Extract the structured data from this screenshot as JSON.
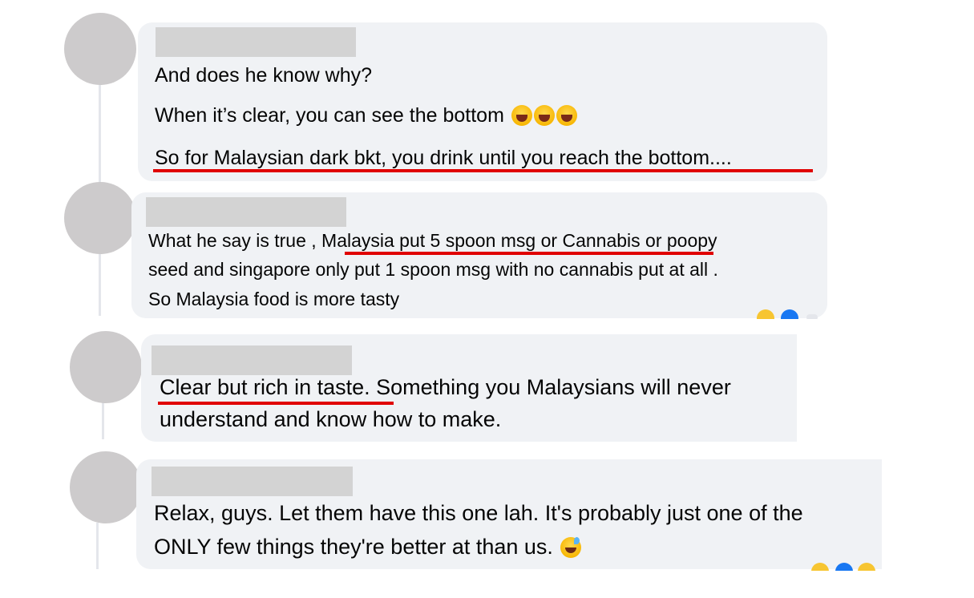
{
  "comments": [
    {
      "lines": [
        "And does he know why?",
        "When it’s clear, you can see the bottom",
        "So for Malaysian dark bkt, you drink until you reach the bottom...."
      ],
      "emoji": [
        "laughing-tears",
        "laughing-tears",
        "laughing-tears"
      ],
      "highlighted": "So for Malaysian dark bkt, you drink until you reach the bottom...."
    },
    {
      "line1_pre": "What he say is true , ",
      "line1_hl": "Malaysia put 5 spoon msg or Cannabis",
      "line1_post": " or poopy",
      "line2": "seed and singapore only put 1 spoon msg with no cannabis put at all .",
      "line3": "So Malaysia food is more tasty",
      "reactions": [
        "haha",
        "like"
      ]
    },
    {
      "line1_hl": "Clear but rich in taste.",
      "line1_post": " Something you Malaysians will never",
      "line2": "understand and know how to make."
    },
    {
      "line1": "Relax, guys. Let them have this one lah. It's probably just one of the",
      "line2": "ONLY few things they're better at than us.",
      "emoji": [
        "sweat-smile"
      ],
      "reactions": [
        "haha",
        "like"
      ]
    }
  ],
  "colors": {
    "bubble_bg": "#f0f2f5",
    "avatar": "#cdcbcc",
    "redaction": "#d3d3d3",
    "underline": "#e00000",
    "text": "#050505"
  }
}
